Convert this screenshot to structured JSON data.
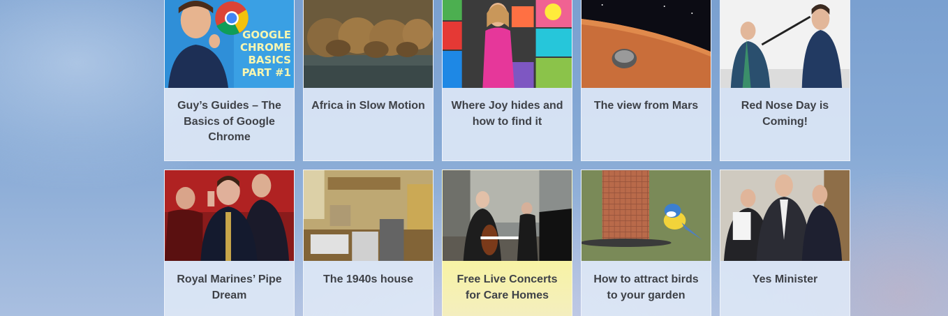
{
  "tiles": [
    {
      "title": "Guy’s Guides – The Basics of Google Chrome",
      "thumb_icon": "presenter-chrome-logo-thumbnail",
      "thumb_text": [
        "GOOGLE",
        "CHROME",
        "BASICS",
        "PART #1"
      ]
    },
    {
      "title": "Africa in Slow Motion",
      "thumb_icon": "lionesses-drinking-thumbnail"
    },
    {
      "title": "Where Joy hides and how to find it",
      "thumb_icon": "speaker-pink-dress-thumbnail"
    },
    {
      "title": "The view from Mars",
      "thumb_icon": "mars-lander-thumbnail"
    },
    {
      "title": "Red Nose Day is Coming!",
      "thumb_icon": "two-people-selfie-stick-thumbnail"
    },
    {
      "title": "Royal Marines’ Pipe Dream",
      "thumb_icon": "marine-on-phone-thumbnail"
    },
    {
      "title": "The 1940s house",
      "thumb_icon": "vintage-kitchen-thumbnail"
    },
    {
      "title": "Free Live Concerts for Care Homes",
      "thumb_icon": "cello-piano-concert-thumbnail"
    },
    {
      "title": "How to attract birds to your garden",
      "thumb_icon": "bird-feeder-blue-tit-thumbnail"
    },
    {
      "title": "Yes Minister",
      "thumb_icon": "three-men-in-suits-thumbnail"
    }
  ],
  "colors": {
    "highlight_tile": "#f5f08a",
    "tile_bg": "#dee8f6",
    "caption_text": "#3e4147"
  }
}
